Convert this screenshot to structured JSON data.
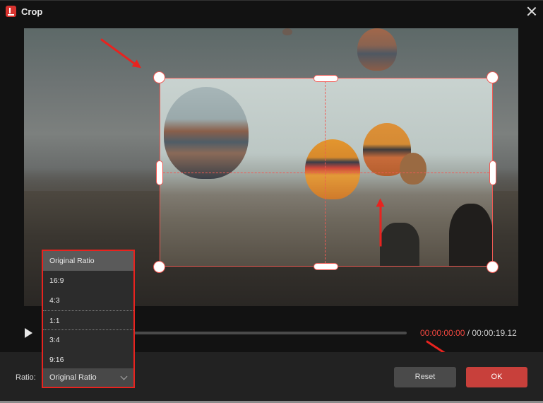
{
  "window": {
    "title": "Crop",
    "app_icon": "app-logo-icon",
    "close_icon": "close-icon"
  },
  "player": {
    "play_icon": "play-icon",
    "current_time": "00:00:00:00",
    "separator": " / ",
    "total_time": "00:00:19.12",
    "progress_fraction": 0.0
  },
  "crop": {
    "handles": [
      "top-left",
      "top",
      "top-right",
      "left",
      "right",
      "bottom-left",
      "bottom",
      "bottom-right"
    ],
    "guides": [
      "vertical-center",
      "horizontal-center"
    ]
  },
  "ratio": {
    "label": "Ratio:",
    "selected": "Original Ratio",
    "options": [
      "Original Ratio",
      "16:9",
      "4:3",
      "1:1",
      "3:4",
      "9:16"
    ],
    "highlighted": "Original Ratio",
    "focused": "1:1"
  },
  "buttons": {
    "reset": "Reset",
    "ok": "OK"
  },
  "annotations": {
    "arrow_color": "#e8231f",
    "accent": "#f05a54",
    "ok_color": "#c8403b",
    "time_color": "#f0473f"
  }
}
